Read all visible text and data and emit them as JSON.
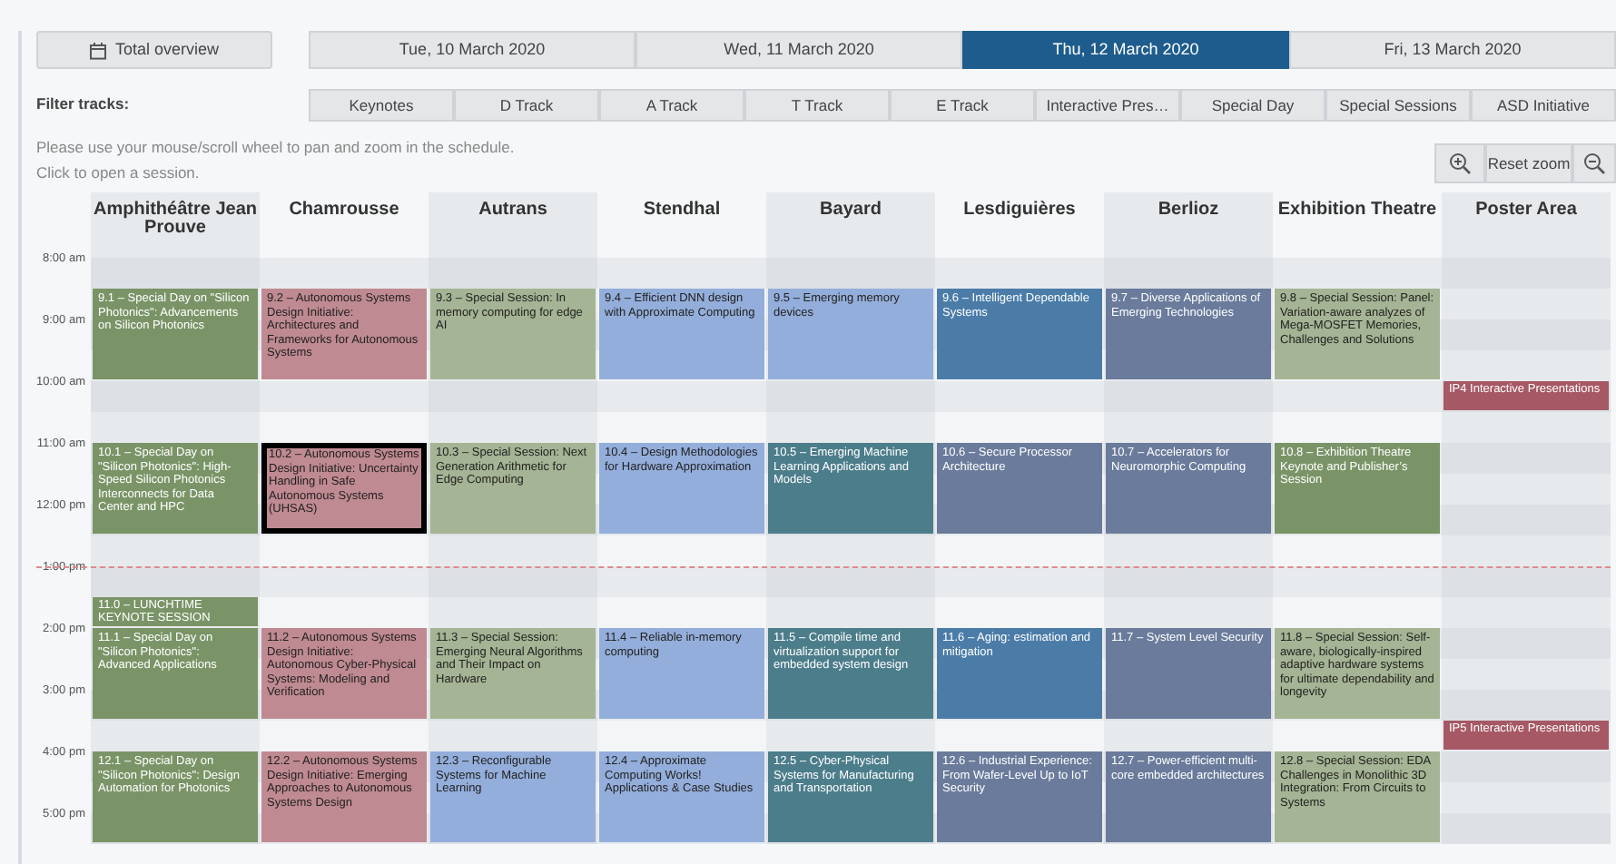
{
  "overview_button": {
    "label": "Total overview"
  },
  "date_tabs": [
    {
      "label": "Tue, 10 March 2020",
      "selected": false
    },
    {
      "label": "Wed, 11 March 2020",
      "selected": false
    },
    {
      "label": "Thu, 12 March 2020",
      "selected": true
    },
    {
      "label": "Fri, 13 March 2020",
      "selected": false
    }
  ],
  "filter": {
    "label": "Filter tracks:",
    "tracks": [
      "Keynotes",
      "D Track",
      "A Track",
      "T Track",
      "E Track",
      "Interactive Pres…",
      "Special Day",
      "Special Sessions",
      "ASD Initiative"
    ]
  },
  "instructions": [
    "Please use your mouse/scroll wheel to pan and zoom in the schedule.",
    "Click to open a session."
  ],
  "zoom_controls": {
    "reset_label": "Reset zoom"
  },
  "schedule": {
    "rooms": [
      "Amphithéâtre Jean Prouve",
      "Chamrousse",
      "Autrans",
      "Stendhal",
      "Bayard",
      "Lesdiguières",
      "Berlioz",
      "Exhibition Theatre",
      "Poster Area"
    ],
    "time_labels": [
      "8:00 am",
      "9:00 am",
      "10:00 am",
      "11:00 am",
      "12:00 pm",
      "1:00 pm",
      "2:00 pm",
      "3:00 pm",
      "4:00 pm",
      "5:00 pm"
    ],
    "bands": [
      {
        "kind": "gap"
      },
      {
        "kind": "main",
        "sessions": [
          {
            "title": "9.1 – Special Day on \"Silicon Photonics\": Advancements on Silicon Photonics",
            "color": "#7a9467",
            "selected": false
          },
          {
            "title": "9.2 – Autonomous Systems Design Initiative: Architectures and Frameworks for Autonomous Systems",
            "color": "#c08a92",
            "selected": false
          },
          {
            "title": "9.3 – Special Session: In memory computing for edge AI",
            "color": "#a5b494",
            "selected": false
          },
          {
            "title": "9.4 – Efficient DNN design with Approximate Computing",
            "color": "#94aedb",
            "selected": false
          },
          {
            "title": "9.5 – Emerging memory devices",
            "color": "#94aedb",
            "selected": false
          },
          {
            "title": "9.6 – Intelligent Dependable Systems",
            "color": "#4b7ca8",
            "selected": false
          },
          {
            "title": "9.7 – Diverse Applications of Emerging Technologies",
            "color": "#6a7b9b",
            "selected": false
          },
          {
            "title": "9.8 – Special Session: Panel: Variation-aware analyzes of Mega-MOSFET Memories, Challenges and Solutions",
            "color": "#a5b494",
            "selected": false
          }
        ]
      },
      {
        "kind": "poster",
        "sessions": [
          {
            "title": "IP4 Interactive Presentations",
            "color": "#a65865",
            "selected": false
          }
        ]
      },
      {
        "kind": "gap"
      },
      {
        "kind": "main",
        "sessions": [
          {
            "title": "10.1 – Special Day on \"Silicon Photonics\": High-Speed Silicon Photonics Interconnects for Data Center and HPC",
            "color": "#7a9467",
            "selected": false
          },
          {
            "title": "10.2 – Autonomous Systems Design Initiative: Uncertainty Handling in Safe Autonomous Systems (UHSAS)",
            "color": "#c08a92",
            "selected": true
          },
          {
            "title": "10.3 – Special Session: Next Generation Arithmetic for Edge Computing",
            "color": "#a5b494",
            "selected": false
          },
          {
            "title": "10.4 – Design Methodologies for Hardware Approximation",
            "color": "#94aedb",
            "selected": false
          },
          {
            "title": "10.5 – Emerging Machine Learning Applications and Models",
            "color": "#4c7d8b",
            "selected": false
          },
          {
            "title": "10.6 – Secure Processor Architecture",
            "color": "#6a7b9b",
            "selected": false
          },
          {
            "title": "10.7 – Accelerators for Neuromorphic Computing",
            "color": "#6a7b9b",
            "selected": false
          },
          {
            "title": "10.8 – Exhibition Theatre Keynote and Publisher’s Session",
            "color": "#7a9467",
            "selected": false
          }
        ]
      },
      {
        "kind": "lunch"
      },
      {
        "kind": "keynote",
        "sessions": [
          {
            "title": "11.0 – LUNCHTIME KEYNOTE SESSION",
            "color": "#7a9467",
            "selected": false
          }
        ]
      },
      {
        "kind": "main",
        "sessions": [
          {
            "title": "11.1 – Special Day on \"Silicon Photonics\": Advanced Applications",
            "color": "#7a9467",
            "selected": false
          },
          {
            "title": "11.2 – Autonomous Systems Design Initiative: Autonomous Cyber-Physical Systems: Modeling and Verification",
            "color": "#c08a92",
            "selected": false
          },
          {
            "title": "11.3 – Special Session: Emerging Neural Algorithms and Their Impact on Hardware",
            "color": "#a5b494",
            "selected": false
          },
          {
            "title": "11.4 – Reliable in-memory computing",
            "color": "#94aedb",
            "selected": false
          },
          {
            "title": "11.5 – Compile time and virtualization support for embedded system design",
            "color": "#4c7d8b",
            "selected": false
          },
          {
            "title": "11.6 – Aging: estimation and mitigation",
            "color": "#4b7ca8",
            "selected": false
          },
          {
            "title": "11.7 – System Level Security",
            "color": "#6a7b9b",
            "selected": false
          },
          {
            "title": "11.8 – Special Session: Self-aware, biologically-inspired adaptive hardware systems for ultimate dependability and longevity",
            "color": "#a5b494",
            "selected": false
          }
        ]
      },
      {
        "kind": "poster",
        "sessions": [
          {
            "title": "IP5 Interactive Presentations",
            "color": "#a65865",
            "selected": false
          }
        ]
      },
      {
        "kind": "main",
        "sessions": [
          {
            "title": "12.1 – Special Day on \"Silicon Photonics\": Design Automation for Photonics",
            "color": "#7a9467",
            "selected": false
          },
          {
            "title": "12.2 – Autonomous Systems Design Initiative: Emerging Approaches to Autonomous Systems Design",
            "color": "#c08a92",
            "selected": false
          },
          {
            "title": "12.3 – Reconfigurable Systems for Machine Learning",
            "color": "#94aedb",
            "selected": false
          },
          {
            "title": "12.4 – Approximate Computing Works! Applications & Case Studies",
            "color": "#94aedb",
            "selected": false
          },
          {
            "title": "12.5 – Cyber-Physical Systems for Manufacturing and Transportation",
            "color": "#4c7d8b",
            "selected": false
          },
          {
            "title": "12.6 – Industrial Experience: From Wafer-Level Up to IoT Security",
            "color": "#6a7b9b",
            "selected": false
          },
          {
            "title": "12.7 – Power-efficient multi-core embedded architectures",
            "color": "#6a7b9b",
            "selected": false
          },
          {
            "title": "12.8 – Special Session: EDA Challenges in Monolithic 3D Integration: From Circuits to Systems",
            "color": "#a5b494",
            "selected": false
          }
        ]
      }
    ]
  }
}
